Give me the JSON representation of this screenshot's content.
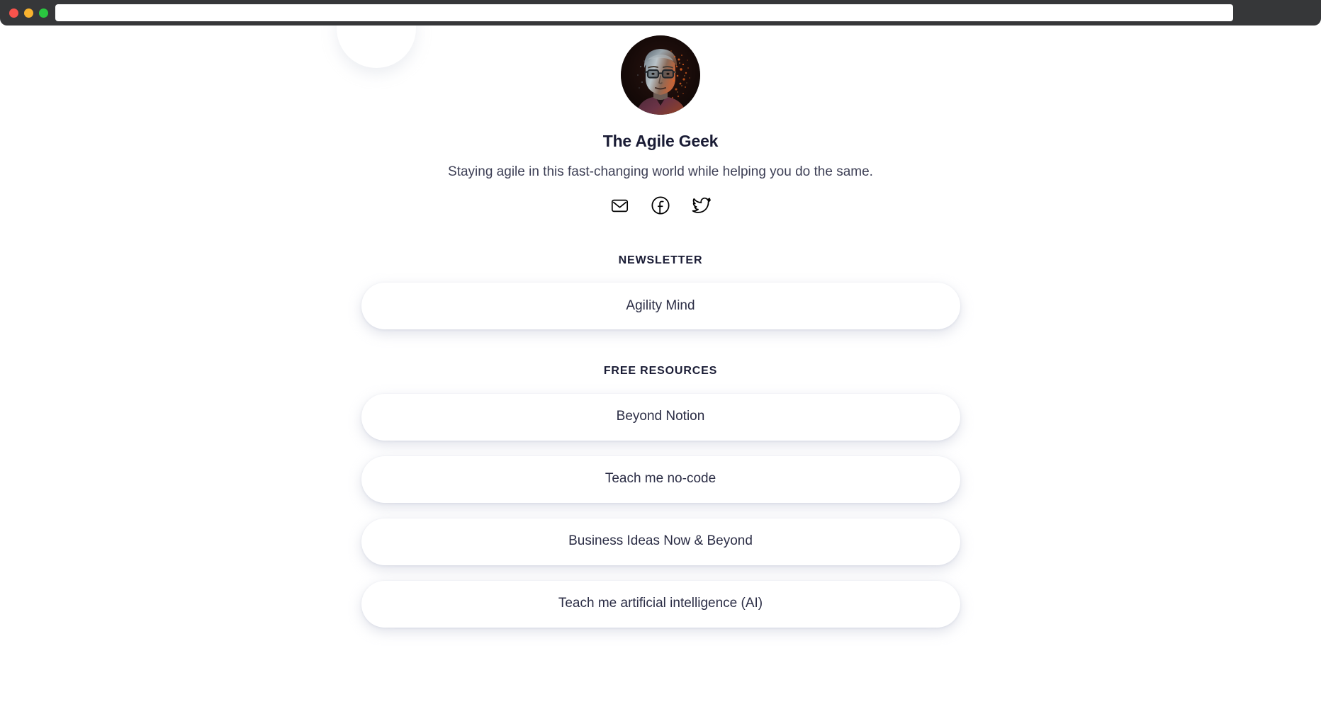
{
  "browser": {
    "traffic_lights": [
      "close",
      "minimize",
      "maximize"
    ],
    "url_value": "",
    "url_placeholder": "",
    "chrome_color": "#363739"
  },
  "profile": {
    "avatar_alt": "The Agile Geek portrait",
    "name": "The Agile Geek",
    "tagline": "Staying agile in this fast-changing world while helping you do the same."
  },
  "social": {
    "links": [
      {
        "icon": "mail-icon",
        "label": "Email"
      },
      {
        "icon": "facebook-icon",
        "label": "Facebook"
      },
      {
        "icon": "twitter-icon",
        "label": "Twitter"
      }
    ]
  },
  "sections": [
    {
      "title": "NEWSLETTER",
      "items": [
        {
          "label": "Agility Mind"
        }
      ]
    },
    {
      "title": "FREE RESOURCES",
      "items": [
        {
          "label": "Beyond Notion"
        },
        {
          "label": "Teach me no-code"
        },
        {
          "label": "Business Ideas Now & Beyond"
        },
        {
          "label": "Teach me artificial intelligence (AI)"
        }
      ]
    }
  ],
  "colors": {
    "page_background": "#ffffff",
    "heading": "#1a1c35",
    "body_text": "#3d3f55",
    "card_text": "#2b2d45",
    "card_background": "#ffffff",
    "traffic_close": "#f9534c",
    "traffic_minimize": "#f9b32f",
    "traffic_maximize": "#2ac840"
  }
}
